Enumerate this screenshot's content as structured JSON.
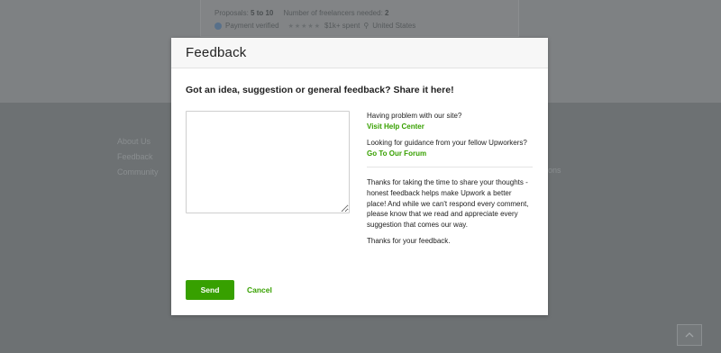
{
  "background": {
    "card": {
      "proposals_label": "Proposals:",
      "proposals_value": "5 to 10",
      "freelancers_label": "Number of freelancers needed:",
      "freelancers_value": "2",
      "payment_status": "Payment verified",
      "rating_stars": "★★★★★",
      "spent": "$1k+ spent",
      "location": "United States"
    },
    "footer_links": [
      "About Us",
      "Feedback",
      "Community"
    ],
    "footer_fragment": "ions"
  },
  "modal": {
    "title": "Feedback",
    "prompt": "Got an idea, suggestion or general feedback? Share it here!",
    "textarea_value": "",
    "help_question": "Having problem with our site?",
    "help_link": "Visit Help Center",
    "forum_question": "Looking for guidance from your fellow Upworkers?",
    "forum_link": "Go To Our Forum",
    "thanks_paragraph": "Thanks for taking the time to share your thoughts - honest feedback helps make Upwork a better place! And while we can't respond every comment, please know that we read and appreciate every suggestion that comes our way.",
    "thanks_short": "Thanks for your feedback.",
    "send_label": "Send",
    "cancel_label": "Cancel"
  },
  "colors": {
    "accent": "#37a000",
    "overlay": "#7c8082"
  }
}
